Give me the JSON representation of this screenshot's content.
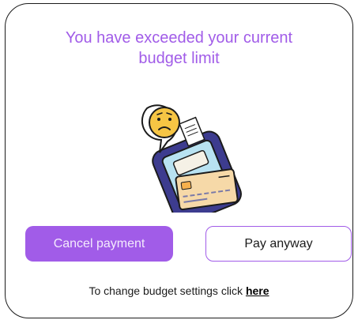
{
  "dialog": {
    "title_line1": "You have exceeded your current",
    "title_line2": "budget limit",
    "illustration_icon": "payment-terminal-sad-face-icon",
    "cancel_label": "Cancel payment",
    "pay_label": "Pay anyway",
    "footer_text": "To change budget settings click ",
    "footer_link": "here"
  },
  "colors": {
    "accent": "#a15ce8",
    "text": "#1b1b1b",
    "background": "#ffffff"
  }
}
